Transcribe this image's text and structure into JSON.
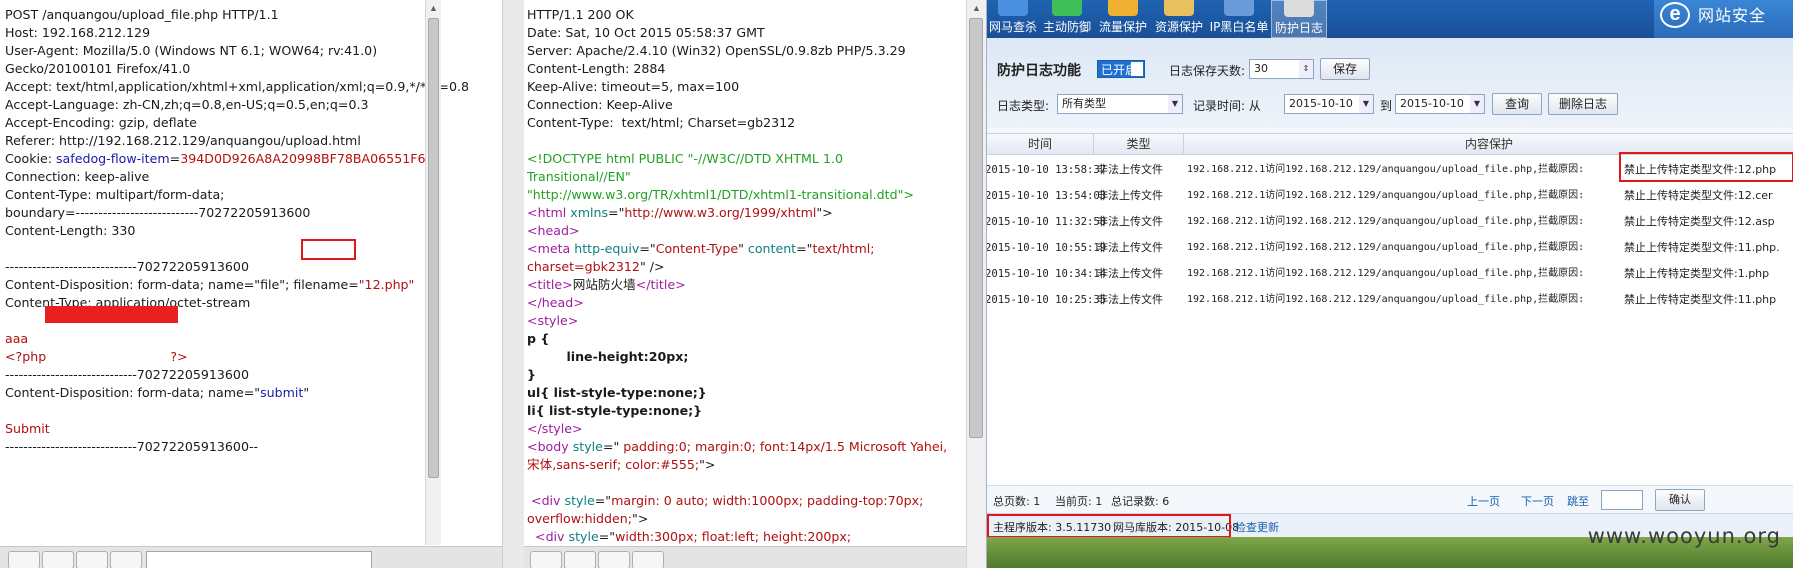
{
  "request": {
    "lines": [
      [
        {
          "t": "POST /anquangou/upload_file.php HTTP/1.1",
          "c": "k"
        }
      ],
      [
        {
          "t": "Host: 192.168.212.129",
          "c": "k"
        }
      ],
      [
        {
          "t": "User-Agent: Mozilla/5.0 (Windows NT 6.1; WOW64; rv:41.0)",
          "c": "k"
        }
      ],
      [
        {
          "t": "Gecko/20100101 Firefox/41.0",
          "c": "k"
        }
      ],
      [
        {
          "t": "Accept: text/html,application/xhtml+xml,application/xml;q=0.9,*/*;q=0.8",
          "c": "k"
        }
      ],
      [
        {
          "t": "Accept-Language: zh-CN,zh;q=0.8,en-US;q=0.5,en;q=0.3",
          "c": "k"
        }
      ],
      [
        {
          "t": "Accept-Encoding: gzip, deflate",
          "c": "k"
        }
      ],
      [
        {
          "t": "Referer: http://192.168.212.129/anquangou/upload.html",
          "c": "k"
        }
      ],
      [
        {
          "t": "Cookie: ",
          "c": "k"
        },
        {
          "t": "safedog-flow-item",
          "c": "b"
        },
        {
          "t": "=",
          "c": "k"
        },
        {
          "t": "394D0D926A8A20998BF78BA06551F6F1",
          "c": "r"
        }
      ],
      [
        {
          "t": "Connection: keep-alive",
          "c": "k"
        }
      ],
      [
        {
          "t": "Content-Type: multipart/form-data;",
          "c": "k"
        }
      ],
      [
        {
          "t": "boundary=---------------------------70272205913600",
          "c": "k"
        }
      ],
      [
        {
          "t": "Content-Length: 330",
          "c": "k"
        }
      ],
      [
        {
          "t": "",
          "c": "k"
        }
      ],
      [
        {
          "t": "-----------------------------70272205913600",
          "c": "k"
        }
      ],
      [
        {
          "t": "Content-Disposition: form-data; name=\"file\"; filename=",
          "c": "k"
        },
        {
          "t": "\"12.php\"",
          "c": "r"
        }
      ],
      [
        {
          "t": "Content-Type: application/octet-stream",
          "c": "k"
        }
      ],
      [
        {
          "t": "",
          "c": "k"
        }
      ],
      [
        {
          "t": "aaa",
          "c": "r"
        }
      ],
      [
        {
          "t": "<?php ",
          "c": "r"
        },
        {
          "t": "                              ",
          "c": "r"
        },
        {
          "t": "?>",
          "c": "r"
        }
      ],
      [
        {
          "t": "-----------------------------70272205913600",
          "c": "k"
        }
      ],
      [
        {
          "t": "Content-Disposition: form-data; name=\"",
          "c": "k"
        },
        {
          "t": "submit",
          "c": "b"
        },
        {
          "t": "\"",
          "c": "k"
        }
      ],
      [
        {
          "t": "",
          "c": "k"
        }
      ],
      [
        {
          "t": "Submit",
          "c": "r"
        }
      ],
      [
        {
          "t": "-----------------------------70272205913600--",
          "c": "k"
        }
      ]
    ]
  },
  "response": {
    "lines": [
      [
        {
          "t": "HTTP/1.1 200 OK",
          "c": "k"
        }
      ],
      [
        {
          "t": "Date: Sat, 10 Oct 2015 05:58:37 GMT",
          "c": "k"
        }
      ],
      [
        {
          "t": "Server: Apache/2.4.10 (Win32) OpenSSL/0.9.8zb PHP/5.3.29",
          "c": "k"
        }
      ],
      [
        {
          "t": "Content-Length: 2884",
          "c": "k"
        }
      ],
      [
        {
          "t": "Keep-Alive: timeout=5, max=100",
          "c": "k"
        }
      ],
      [
        {
          "t": "Connection: Keep-Alive",
          "c": "k"
        }
      ],
      [
        {
          "t": "Content-Type:  text/html; Charset=gb2312",
          "c": "k"
        }
      ],
      [
        {
          "t": "",
          "c": "k"
        }
      ],
      [
        {
          "t": "<!DOCTYPE html PUBLIC \"-//W3C//DTD XHTML 1.0",
          "c": "g"
        }
      ],
      [
        {
          "t": "Transitional//EN\"",
          "c": "g"
        }
      ],
      [
        {
          "t": "\"http://www.w3.org/TR/xhtml1/DTD/xhtml1-transitional.dtd\">",
          "c": "g"
        }
      ],
      [
        {
          "t": "<",
          "c": "p"
        },
        {
          "t": "html ",
          "c": "p"
        },
        {
          "t": "xmlns",
          "c": "t"
        },
        {
          "t": "=\"",
          "c": "k"
        },
        {
          "t": "http://www.w3.org/1999/xhtml",
          "c": "r"
        },
        {
          "t": "\">",
          "c": "k"
        }
      ],
      [
        {
          "t": "<head>",
          "c": "p"
        }
      ],
      [
        {
          "t": "<",
          "c": "p"
        },
        {
          "t": "meta ",
          "c": "p"
        },
        {
          "t": "http-equiv",
          "c": "t"
        },
        {
          "t": "=\"",
          "c": "k"
        },
        {
          "t": "Content-Type",
          "c": "r"
        },
        {
          "t": "\" ",
          "c": "k"
        },
        {
          "t": "content",
          "c": "t"
        },
        {
          "t": "=\"",
          "c": "k"
        },
        {
          "t": "text/html;",
          "c": "r"
        }
      ],
      [
        {
          "t": "charset=gbk2312",
          "c": "r"
        },
        {
          "t": "\" />",
          "c": "k"
        }
      ],
      [
        {
          "t": "<title>",
          "c": "p"
        },
        {
          "t": "网站防火墙",
          "c": "k"
        },
        {
          "t": "</title>",
          "c": "p"
        }
      ],
      [
        {
          "t": "</head>",
          "c": "p"
        }
      ],
      [
        {
          "t": "<style>",
          "c": "p"
        }
      ],
      [
        {
          "t": "p {",
          "c": "kb"
        }
      ],
      [
        {
          "t": "         line-height:20px;",
          "c": "kb"
        }
      ],
      [
        {
          "t": "}",
          "c": "kb"
        }
      ],
      [
        {
          "t": "ul{ list-style-type:none;}",
          "c": "kb"
        }
      ],
      [
        {
          "t": "li{ list-style-type:none;}",
          "c": "kb"
        }
      ],
      [
        {
          "t": "</style>",
          "c": "p"
        }
      ],
      [
        {
          "t": "<",
          "c": "p"
        },
        {
          "t": "body ",
          "c": "p"
        },
        {
          "t": "style",
          "c": "t"
        },
        {
          "t": "=\"",
          "c": "k"
        },
        {
          "t": " padding:0; margin:0; font:14px/1.5 Microsoft Yahei,",
          "c": "r"
        }
      ],
      [
        {
          "t": "宋体,sans-serif; color:#555;",
          "c": "r"
        },
        {
          "t": "\">",
          "c": "k"
        }
      ],
      [
        {
          "t": "",
          "c": "k"
        }
      ],
      [
        {
          "t": " <",
          "c": "p"
        },
        {
          "t": "div ",
          "c": "p"
        },
        {
          "t": "style",
          "c": "t"
        },
        {
          "t": "=\"",
          "c": "k"
        },
        {
          "t": "margin: 0 auto; width:1000px; padding-top:70px;",
          "c": "r"
        }
      ],
      [
        {
          "t": "overflow:hidden;",
          "c": "r"
        },
        {
          "t": "\">",
          "c": "k"
        }
      ],
      [
        {
          "t": "  <",
          "c": "p"
        },
        {
          "t": "div ",
          "c": "p"
        },
        {
          "t": "style",
          "c": "t"
        },
        {
          "t": "=\"",
          "c": "k"
        },
        {
          "t": "width:300px; float:left; height:200px;",
          "c": "r"
        }
      ],
      [
        {
          "t": "background:url(http://404.safedog.cn/images/safedogsite/broswer_",
          "c": "r"
        }
      ]
    ]
  },
  "app": {
    "nav": [
      {
        "label": "网马查杀",
        "color": "#4a8fe0"
      },
      {
        "label": "主动防御",
        "color": "#3fbf5a"
      },
      {
        "label": "流量保护",
        "color": "#f0b030"
      },
      {
        "label": "资源保护",
        "color": "#e8c060"
      },
      {
        "label": "IP黑白名单",
        "color": "#6a9ad8"
      },
      {
        "label": "防护日志",
        "color": "#dcdcdc"
      }
    ],
    "brand_text": "网站安全",
    "log_title": "防护日志功能",
    "enabled_label": "已开启",
    "keep_days_label": "日志保存天数:",
    "keep_days_value": "30",
    "save_label": "保存",
    "log_type_label": "日志类型:",
    "log_type_value": "所有类型",
    "record_time_label": "记录时间: 从",
    "date_from": "2015-10-10",
    "to_label": "到",
    "date_to": "2015-10-10",
    "query_label": "查询",
    "delete_label": "删除日志",
    "headers": {
      "time": "时间",
      "type": "类型",
      "content": "内容保护"
    },
    "rows": [
      {
        "time": "2015-10-10 13:58:37",
        "type": "非法上传文件",
        "content": "192.168.212.1访问192.168.212.129/anquangou/upload_file.php,拦截原因:",
        "reason": "禁止上传特定类型文件:12.php"
      },
      {
        "time": "2015-10-10 13:54:03",
        "type": "非法上传文件",
        "content": "192.168.212.1访问192.168.212.129/anquangou/upload_file.php,拦截原因:",
        "reason": "禁止上传特定类型文件:12.cer"
      },
      {
        "time": "2015-10-10 11:32:58",
        "type": "非法上传文件",
        "content": "192.168.212.1访问192.168.212.129/anquangou/upload_file.php,拦截原因:",
        "reason": "禁止上传特定类型文件:12.asp"
      },
      {
        "time": "2015-10-10 10:55:19",
        "type": "非法上传文件",
        "content": "192.168.212.1访问192.168.212.129/anquangou/upload_file.php,拦截原因:",
        "reason": "禁止上传特定类型文件:11.php."
      },
      {
        "time": "2015-10-10 10:34:14",
        "type": "非法上传文件",
        "content": "192.168.212.1访问192.168.212.129/anquangou/upload_file.php,拦截原因:",
        "reason": "禁止上传特定类型文件:1.php"
      },
      {
        "time": "2015-10-10 10:25:35",
        "type": "非法上传文件",
        "content": "192.168.212.1访问192.168.212.129/anquangou/upload_file.php,拦截原因:",
        "reason": "禁止上传特定类型文件:11.php"
      }
    ],
    "pager": {
      "total_pages": "总页数: 1",
      "current_page": "当前页: 1",
      "total_records": "总记录数: 6",
      "prev": "上一页",
      "next": "下一页",
      "jump": "跳至",
      "confirm": "确认"
    },
    "status": {
      "main_version": "主程序版本: 3.5.11730",
      "db_version": "网马库版本: 2015-10-08",
      "check_update": "检查更新"
    },
    "watermark": "www.wooyun.org"
  }
}
